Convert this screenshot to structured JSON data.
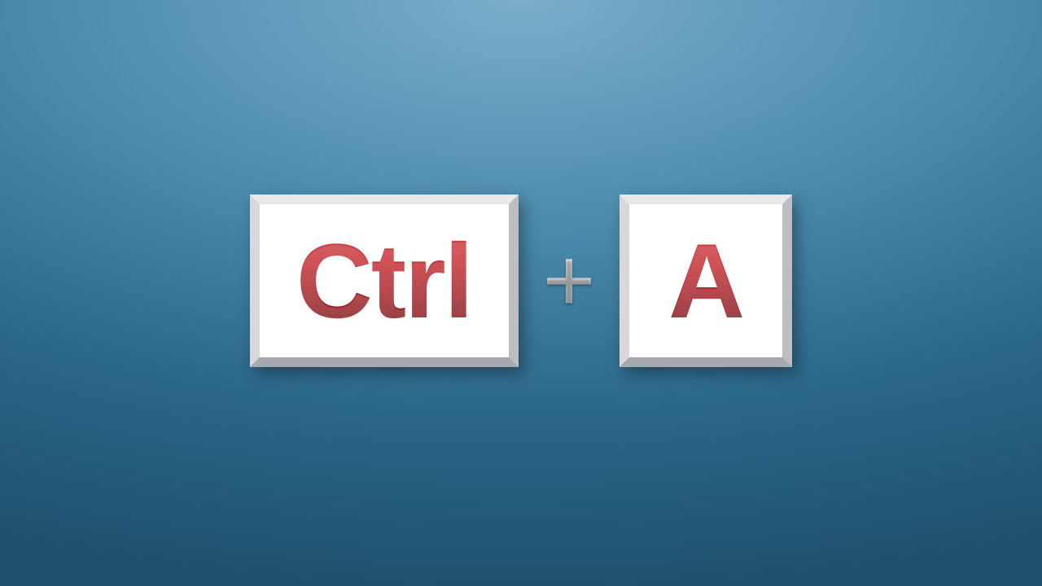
{
  "shortcut": {
    "key1": "Ctrl",
    "separator": "+",
    "key2": "A"
  }
}
